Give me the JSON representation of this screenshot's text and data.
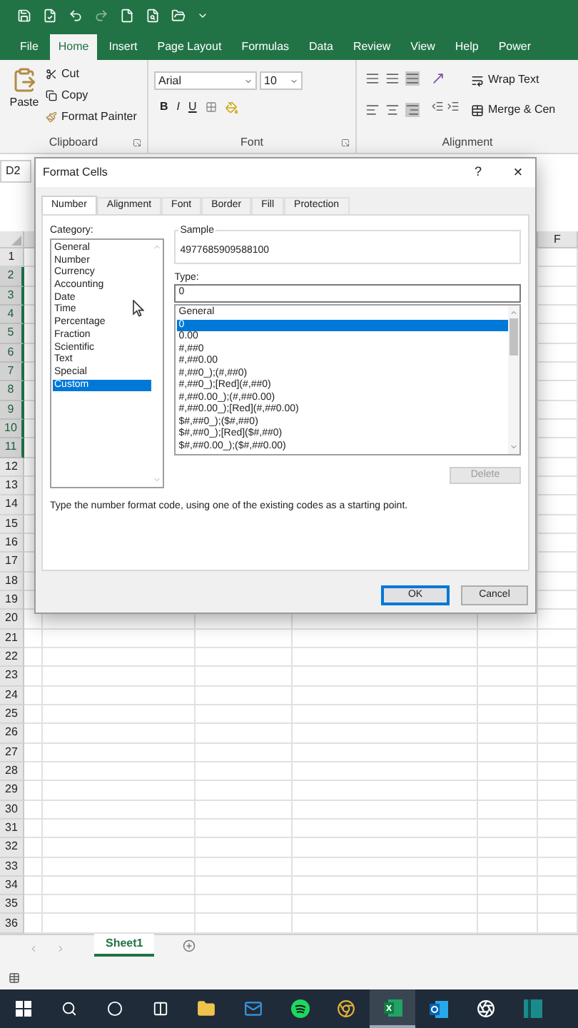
{
  "ribbon_tabs": [
    {
      "label": "File",
      "selected": false
    },
    {
      "label": "Home",
      "selected": true
    },
    {
      "label": "Insert",
      "selected": false
    },
    {
      "label": "Page Layout",
      "selected": false
    },
    {
      "label": "Formulas",
      "selected": false
    },
    {
      "label": "Data",
      "selected": false
    },
    {
      "label": "Review",
      "selected": false
    },
    {
      "label": "View",
      "selected": false
    },
    {
      "label": "Help",
      "selected": false
    },
    {
      "label": "Power",
      "selected": false
    }
  ],
  "ribbon": {
    "clipboard": {
      "paste": "Paste",
      "cut": "Cut",
      "copy": "Copy",
      "format_painter": "Format Painter",
      "label": "Clipboard"
    },
    "font": {
      "name": "Arial",
      "size": "10",
      "bold": "B",
      "italic": "I",
      "underline": "U",
      "label": "Font"
    },
    "alignment": {
      "wrap_text": "Wrap Text",
      "merge": "Merge & Cen",
      "label": "Alignment"
    }
  },
  "name_box": "D2",
  "sheet": {
    "column_label": "F",
    "rows": [
      {
        "label": "1",
        "selected": false
      },
      {
        "label": "2",
        "selected": true
      },
      {
        "label": "3",
        "selected": true
      },
      {
        "label": "4",
        "selected": true
      },
      {
        "label": "5",
        "selected": true
      },
      {
        "label": "6",
        "selected": true
      },
      {
        "label": "7",
        "selected": true
      },
      {
        "label": "8",
        "selected": true
      },
      {
        "label": "9",
        "selected": true
      },
      {
        "label": "10",
        "selected": true
      },
      {
        "label": "11",
        "selected": true
      },
      {
        "label": "12",
        "selected": false
      },
      {
        "label": "13",
        "selected": false
      },
      {
        "label": "14",
        "selected": false
      },
      {
        "label": "15",
        "selected": false
      },
      {
        "label": "16",
        "selected": false
      },
      {
        "label": "17",
        "selected": false
      },
      {
        "label": "18",
        "selected": false
      },
      {
        "label": "19",
        "selected": false
      },
      {
        "label": "20",
        "selected": false
      },
      {
        "label": "21",
        "selected": false
      },
      {
        "label": "22",
        "selected": false
      },
      {
        "label": "23",
        "selected": false
      },
      {
        "label": "24",
        "selected": false
      },
      {
        "label": "25",
        "selected": false
      },
      {
        "label": "26",
        "selected": false
      },
      {
        "label": "27",
        "selected": false
      },
      {
        "label": "28",
        "selected": false
      },
      {
        "label": "29",
        "selected": false
      },
      {
        "label": "30",
        "selected": false
      },
      {
        "label": "31",
        "selected": false
      },
      {
        "label": "32",
        "selected": false
      },
      {
        "label": "33",
        "selected": false
      },
      {
        "label": "34",
        "selected": false
      },
      {
        "label": "35",
        "selected": false
      },
      {
        "label": "36",
        "selected": false
      }
    ]
  },
  "dialog": {
    "title": "Format Cells",
    "help": "?",
    "close": "×",
    "tabs": [
      {
        "label": "Number",
        "selected": true
      },
      {
        "label": "Alignment",
        "selected": false
      },
      {
        "label": "Font",
        "selected": false
      },
      {
        "label": "Border",
        "selected": false
      },
      {
        "label": "Fill",
        "selected": false
      },
      {
        "label": "Protection",
        "selected": false
      }
    ],
    "category_label": "Category:",
    "categories": [
      {
        "label": "General",
        "selected": false
      },
      {
        "label": "Number",
        "selected": false
      },
      {
        "label": "Currency",
        "selected": false
      },
      {
        "label": "Accounting",
        "selected": false
      },
      {
        "label": "Date",
        "selected": false
      },
      {
        "label": "Time",
        "selected": false
      },
      {
        "label": "Percentage",
        "selected": false
      },
      {
        "label": "Fraction",
        "selected": false
      },
      {
        "label": "Scientific",
        "selected": false
      },
      {
        "label": "Text",
        "selected": false
      },
      {
        "label": "Special",
        "selected": false
      },
      {
        "label": "Custom",
        "selected": true
      }
    ],
    "sample_label": "Sample",
    "sample_value": "4977685909588100",
    "type_label": "Type:",
    "type_value": "0",
    "formats": [
      {
        "label": "General",
        "selected": false
      },
      {
        "label": "0",
        "selected": true
      },
      {
        "label": "0.00",
        "selected": false
      },
      {
        "label": "#,##0",
        "selected": false
      },
      {
        "label": "#,##0.00",
        "selected": false
      },
      {
        "label": "#,##0_);(#,##0)",
        "selected": false
      },
      {
        "label": "#,##0_);[Red](#,##0)",
        "selected": false
      },
      {
        "label": "#,##0.00_);(#,##0.00)",
        "selected": false
      },
      {
        "label": "#,##0.00_);[Red](#,##0.00)",
        "selected": false
      },
      {
        "label": "$#,##0_);($#,##0)",
        "selected": false
      },
      {
        "label": "$#,##0_);[Red]($#,##0)",
        "selected": false
      },
      {
        "label": "$#,##0.00_);($#,##0.00)",
        "selected": false
      }
    ],
    "delete": {
      "label": "Delete",
      "disabled": true
    },
    "description": "Type the number format code, using one of the existing codes as a starting point.",
    "ok": "OK",
    "cancel": "Cancel"
  },
  "sheet_tabs": [
    {
      "label": "Sheet1",
      "selected": true
    }
  ]
}
